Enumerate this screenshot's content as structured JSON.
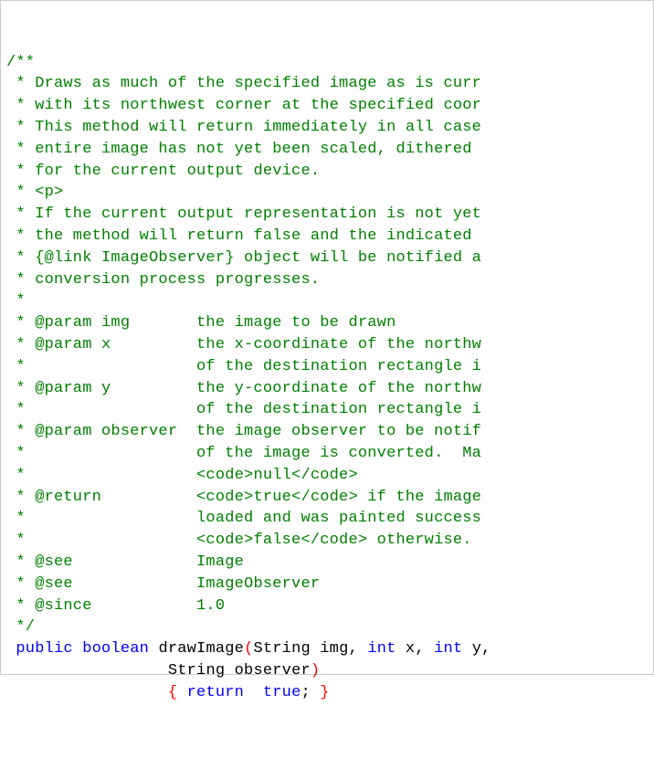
{
  "lines": [
    {
      "cls": "c-green",
      "text": "/**"
    },
    {
      "cls": "c-green",
      "text": " * Draws as much of the specified image as is curr"
    },
    {
      "cls": "c-green",
      "text": " * with its northwest corner at the specified coor"
    },
    {
      "cls": "c-green",
      "text": " * This method will return immediately in all case"
    },
    {
      "cls": "c-green",
      "text": " * entire image has not yet been scaled, dithered "
    },
    {
      "cls": "c-green",
      "text": " * for the current output device."
    },
    {
      "cls": "c-green",
      "text": " * <p>"
    },
    {
      "cls": "c-green",
      "text": " * If the current output representation is not yet"
    },
    {
      "cls": "c-green",
      "text": " * the method will return false and the indicated "
    },
    {
      "cls": "c-green",
      "text": " * {@link ImageObserver} object will be notified a"
    },
    {
      "cls": "c-green",
      "text": " * conversion process progresses."
    },
    {
      "cls": "c-green",
      "text": " *"
    },
    {
      "cls": "c-green",
      "text": " * @param img       the image to be drawn"
    },
    {
      "cls": "c-green",
      "text": " * @param x         the x-coordinate of the northw"
    },
    {
      "cls": "c-green",
      "text": " *                  of the destination rectangle i"
    },
    {
      "cls": "c-green",
      "text": " * @param y         the y-coordinate of the northw"
    },
    {
      "cls": "c-green",
      "text": " *                  of the destination rectangle i"
    },
    {
      "cls": "c-green",
      "text": " * @param observer  the image observer to be notif"
    },
    {
      "cls": "c-green",
      "text": " *                  of the image is converted.  Ma"
    },
    {
      "cls": "c-green",
      "text": " *                  <code>null</code>"
    },
    {
      "cls": "c-green",
      "text": " * @return          <code>true</code> if the image"
    },
    {
      "cls": "c-green",
      "text": " *                  loaded and was painted success"
    },
    {
      "cls": "c-green",
      "text": " *                  <code>false</code> otherwise."
    },
    {
      "cls": "c-green",
      "text": " * @see             Image"
    },
    {
      "cls": "c-green",
      "text": " * @see             ImageObserver"
    },
    {
      "cls": "c-green",
      "text": " * @since           1.0"
    },
    {
      "cls": "c-green",
      "text": " */"
    }
  ],
  "sig": {
    "kw_public": " public ",
    "kw_boolean": "boolean ",
    "method": "drawImage",
    "paren_open": "(",
    "type_string1": "String ",
    "param_img": "img",
    "comma1": ", ",
    "kw_int1": "int ",
    "param_x": "x",
    "comma2": ", ",
    "kw_int2": "int ",
    "param_y": "y",
    "comma3": ", ",
    "indent2": "                 ",
    "type_string2": "String ",
    "param_observer": "observer",
    "paren_close": ")",
    "indent3": "                 ",
    "brace_open": "{ ",
    "kw_return": "return  ",
    "kw_true": "true",
    "semi": ";",
    "brace_close": " }"
  }
}
